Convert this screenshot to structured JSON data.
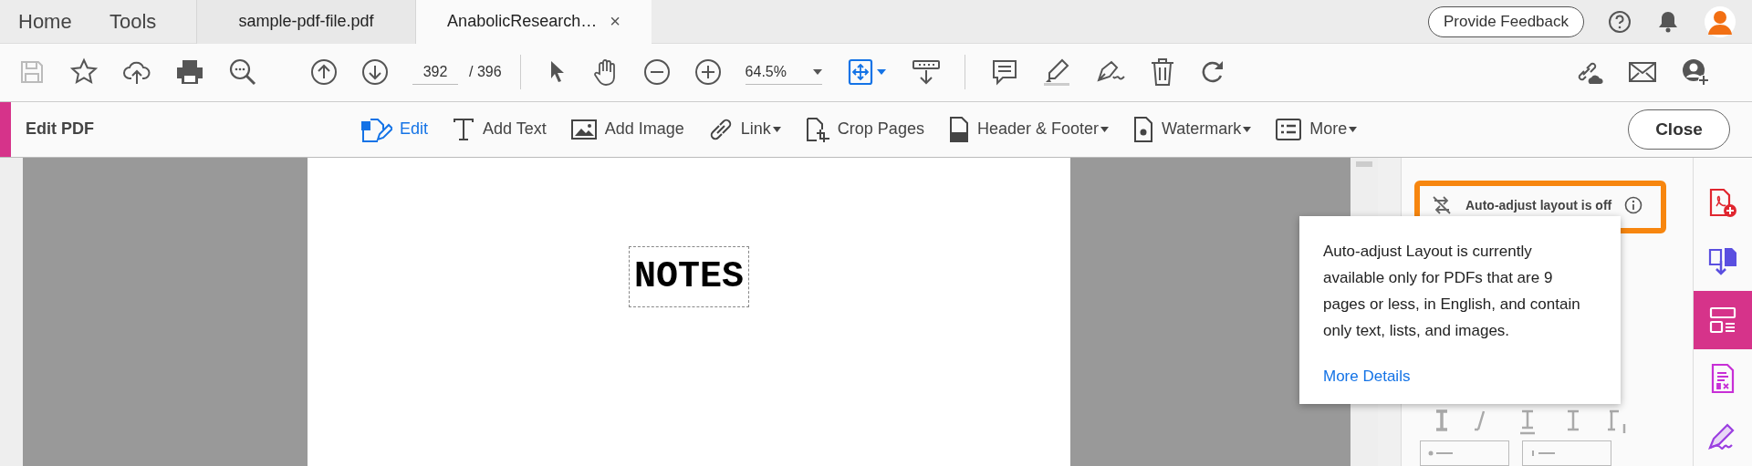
{
  "top_nav": {
    "items": [
      "Home",
      "Tools"
    ]
  },
  "tabs": [
    {
      "label": "sample-pdf-file.pdf",
      "selected": false,
      "closable": false
    },
    {
      "label": "AnabolicResearch…",
      "selected": true,
      "closable": true
    }
  ],
  "close_glyph": "×",
  "feedback_button": "Provide Feedback",
  "toolbar": {
    "page_current": "392",
    "page_total": "/ 396",
    "zoom": "64.5%"
  },
  "edit_bar": {
    "title": "Edit PDF",
    "close": "Close",
    "tools": [
      {
        "label": "Edit",
        "kind": "edit",
        "selected": true,
        "has_menu": false
      },
      {
        "label": "Add Text",
        "kind": "text",
        "selected": false,
        "has_menu": false
      },
      {
        "label": "Add Image",
        "kind": "image",
        "selected": false,
        "has_menu": false
      },
      {
        "label": "Link",
        "kind": "link",
        "selected": false,
        "has_menu": true
      },
      {
        "label": "Crop Pages",
        "kind": "crop",
        "selected": false,
        "has_menu": false
      },
      {
        "label": "Header & Footer",
        "kind": "header",
        "selected": false,
        "has_menu": true
      },
      {
        "label": "Watermark",
        "kind": "watermark",
        "selected": false,
        "has_menu": true
      },
      {
        "label": "More",
        "kind": "more",
        "selected": false,
        "has_menu": true
      }
    ]
  },
  "document": {
    "heading": "NOTES"
  },
  "panel": {
    "layout_status": "Auto-adjust layout is off",
    "highlighted": true,
    "popup": {
      "text": "Auto-adjust Layout is currently available only for PDFs that are 9 pages or less, in English, and contain only text, lists, and images.",
      "link": "More Details"
    }
  },
  "rail": [
    {
      "kind": "create",
      "selected": false
    },
    {
      "kind": "export",
      "selected": false
    },
    {
      "kind": "edit",
      "selected": true
    },
    {
      "kind": "forms",
      "selected": false
    },
    {
      "kind": "sign",
      "selected": false
    }
  ]
}
